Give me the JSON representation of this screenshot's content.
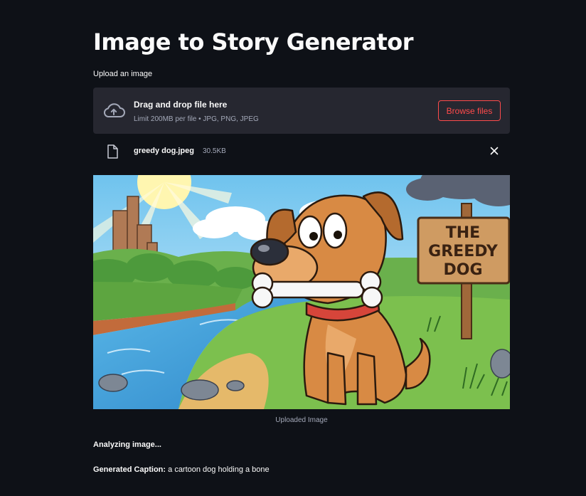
{
  "app": {
    "title": "Image to Story Generator"
  },
  "uploader": {
    "label": "Upload an image",
    "drop_title": "Drag and drop file here",
    "drop_hint": "Limit 200MB per file • JPG, PNG, JPEG",
    "browse_label": "Browse files",
    "icon": "cloud-upload-icon"
  },
  "file": {
    "name": "greedy dog.jpeg",
    "size": "30.5KB",
    "icon": "file-icon",
    "remove_icon": "close-icon"
  },
  "image": {
    "sign_line1": "THE",
    "sign_line2": "GREEDY",
    "sign_line3": "DOG",
    "caption": "Uploaded Image"
  },
  "output": {
    "status": "Analyzing image...",
    "caption_label": "Generated Caption:",
    "caption_text": "a cartoon dog holding a bone"
  },
  "colors": {
    "background": "#0e1117",
    "dropzone": "#262730",
    "accent": "#ff4b4b",
    "muted_text": "#a3a8b8"
  }
}
